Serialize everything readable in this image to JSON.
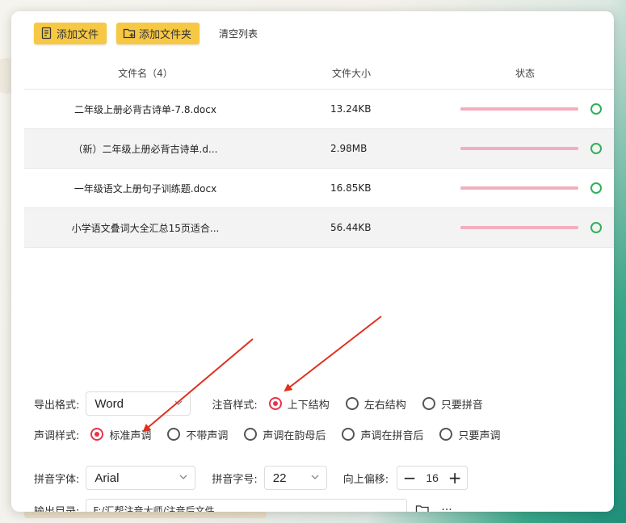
{
  "toolbar": {
    "add_file_label": "添加文件",
    "add_folder_label": "添加文件夹",
    "clear_list_label": "清空列表"
  },
  "table": {
    "headers": {
      "name": "文件名（4）",
      "size": "文件大小",
      "status": "状态"
    },
    "rows": [
      {
        "name": "二年级上册必背古诗单-7.8.docx",
        "size": "13.24KB",
        "progress": 100
      },
      {
        "name": "（新）二年级上册必背古诗单.d...",
        "size": "2.98MB",
        "progress": 100
      },
      {
        "name": "一年级语文上册句子训练题.docx",
        "size": "16.85KB",
        "progress": 100
      },
      {
        "name": "小学语文叠词大全汇总15页适合...",
        "size": "56.44KB",
        "progress": 100
      }
    ]
  },
  "settings": {
    "export_format_label": "导出格式:",
    "export_format_value": "Word",
    "annotation_style_label": "注音样式:",
    "annotation_options": [
      "上下结构",
      "左右结构",
      "只要拼音"
    ],
    "tone_style_label": "声调样式:",
    "tone_options": [
      "标准声调",
      "不带声调",
      "声调在韵母后",
      "声调在拼音后",
      "只要声调"
    ],
    "pinyin_font_label": "拼音字体:",
    "pinyin_font_value": "Arial",
    "pinyin_size_label": "拼音字号:",
    "pinyin_size_value": "22",
    "offset_label": "向上偏移:",
    "offset_value": "16",
    "output_dir_label": "输出目录:",
    "output_dir_value": "F:/汇帮注音大师/注音后文件"
  },
  "colors": {
    "accent_button": "#f7c843",
    "radio_selected": "#e8334a",
    "progress": "#f2aebf",
    "status_ok": "#2fb15a",
    "arrow": "#e0301e"
  }
}
